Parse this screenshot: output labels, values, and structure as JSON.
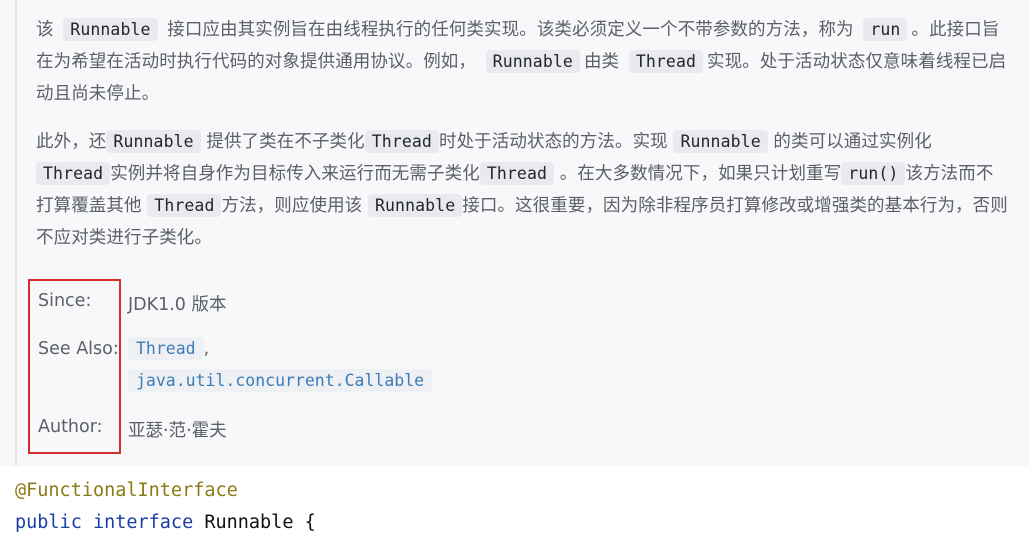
{
  "doc": {
    "para1": {
      "t1": "该",
      "c1": "Runnable",
      "t2": "接口应由其实例旨在由线程执行的任何类实现。该类必须定义一个不带参数的方法，称为",
      "c2": "run",
      "t3": "。此接口旨在为希望在活动时执行代码的对象提供通用协议。例如，",
      "c3": "Runnable",
      "t4": "由类",
      "c4": "Thread",
      "t5": "实现。处于活动状态仅意味着线程已启动且尚未停止。"
    },
    "para2": {
      "t1": "此外，还",
      "c1": "Runnable",
      "t2": "提供了类在不子类化",
      "c2": "Thread",
      "t3": "时处于活动状态的方法。实现",
      "c3": "Runnable",
      "t4": "的类可以通过实例化",
      "c4": "Thread",
      "t5": "实例并将自身作为目标传入来运行而无需子类化",
      "c5": "Thread",
      "t6": "。在大多数情况下，如果只计划重写",
      "c6": "run()",
      "t7": "该方法而不打算覆盖其他",
      "c7": "Thread",
      "t8": "方法，则应使用该",
      "c8": "Runnable",
      "t9": "接口。这很重要，因为除非程序员打算修改或增强类的基本行为，否则不应对类进行子类化。"
    },
    "tags": {
      "since_label": "Since:",
      "since_value": "JDK1.0 版本",
      "see_also_label": "See Also:",
      "see_also_link1": "Thread",
      "see_also_sep": ",",
      "see_also_link2": "java.util.concurrent.Callable",
      "author_label": "Author:",
      "author_value": "亚瑟·范·霍夫"
    }
  },
  "source": {
    "annotation": "@FunctionalInterface",
    "kw_public": "public",
    "kw_interface": "interface",
    "class_name": "Runnable",
    "brace": "{"
  },
  "colors": {
    "highlight_box": "#d32f2f",
    "link": "#3d7cb8",
    "keyword": "#1b3fa6",
    "annotation": "#8c7a16"
  }
}
